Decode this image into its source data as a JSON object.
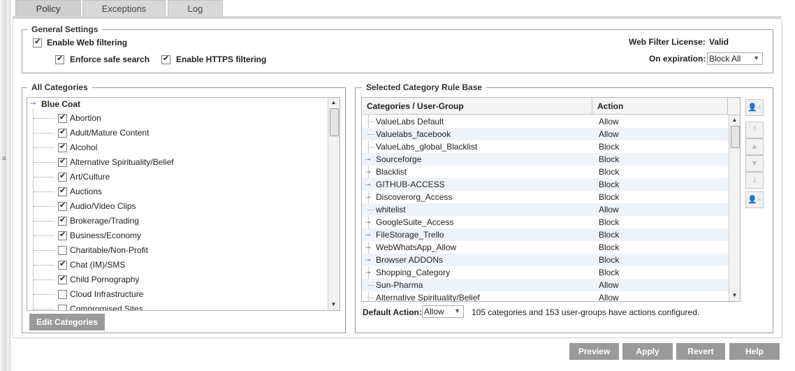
{
  "tabs": [
    {
      "label": "Policy",
      "active": true
    },
    {
      "label": "Exceptions",
      "active": false
    },
    {
      "label": "Log",
      "active": false
    }
  ],
  "general_settings": {
    "legend": "General Settings",
    "enable_web_filtering": {
      "label": "Enable Web filtering",
      "checked": true
    },
    "enforce_safe_search": {
      "label": "Enforce safe search",
      "checked": true
    },
    "enable_https_filtering": {
      "label": "Enable HTTPS filtering",
      "checked": true
    },
    "license_label": "Web Filter License:",
    "license_value": "Valid",
    "expiration_label": "On expiration:",
    "expiration_value": "Block All"
  },
  "all_categories": {
    "legend": "All Categories",
    "root": "Blue Coat",
    "items": [
      {
        "label": "Abortion",
        "checked": true
      },
      {
        "label": "Adult/Mature Content",
        "checked": true
      },
      {
        "label": "Alcohol",
        "checked": true
      },
      {
        "label": "Alternative Spirituality/Belief",
        "checked": true
      },
      {
        "label": "Art/Culture",
        "checked": true
      },
      {
        "label": "Auctions",
        "checked": true
      },
      {
        "label": "Audio/Video Clips",
        "checked": true
      },
      {
        "label": "Brokerage/Trading",
        "checked": true
      },
      {
        "label": "Business/Economy",
        "checked": true
      },
      {
        "label": "Charitable/Non-Profit",
        "checked": false
      },
      {
        "label": "Chat (IM)/SMS",
        "checked": true
      },
      {
        "label": "Child Pornography",
        "checked": true
      },
      {
        "label": "Cloud Infrastructure",
        "checked": false
      },
      {
        "label": "Compromised Sites",
        "checked": false
      }
    ],
    "edit_button": "Edit Categories"
  },
  "rule_base": {
    "legend": "Selected Category Rule Base",
    "columns": [
      "Categories / User-Group",
      "Action"
    ],
    "rows": [
      {
        "name": "ValueLabs Default",
        "action": "Allow",
        "expandable": false
      },
      {
        "name": "Valuelabs_facebook",
        "action": "Allow",
        "expandable": false
      },
      {
        "name": "ValueLabs_global_Blacklist",
        "action": "Block",
        "expandable": false
      },
      {
        "name": "Sourceforge",
        "action": "Block",
        "expandable": true
      },
      {
        "name": "Blacklist",
        "action": "Block",
        "expandable": true
      },
      {
        "name": "GITHUB-ACCESS",
        "action": "Block",
        "expandable": true
      },
      {
        "name": "Discoverorg_Access",
        "action": "Block",
        "expandable": true
      },
      {
        "name": "whitelist",
        "action": "Allow",
        "expandable": false
      },
      {
        "name": "GoogleSuite_Access",
        "action": "Block",
        "expandable": true
      },
      {
        "name": "FileStorage_Trello",
        "action": "Block",
        "expandable": true
      },
      {
        "name": "WebWhatsApp_Allow",
        "action": "Block",
        "expandable": true
      },
      {
        "name": "Browser ADDONs",
        "action": "Block",
        "expandable": true
      },
      {
        "name": "Shopping_Category",
        "action": "Block",
        "expandable": true
      },
      {
        "name": "Sun-Pharma",
        "action": "Allow",
        "expandable": false
      },
      {
        "name": "Alternative Spirituality/Belief",
        "action": "Allow",
        "expandable": false
      }
    ],
    "default_action_label": "Default Action:",
    "default_action_value": "Allow",
    "summary": "105 categories and 153 user-groups have actions configured."
  },
  "footer_buttons": [
    "Preview",
    "Apply",
    "Revert",
    "Help"
  ]
}
